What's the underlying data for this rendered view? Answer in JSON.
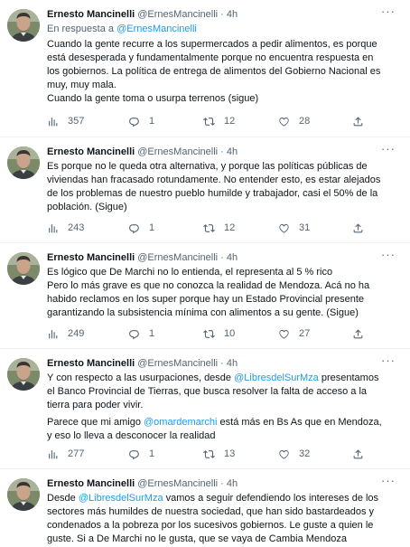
{
  "icons": {
    "more": "more-horizontal-icon",
    "views": "analytics-icon",
    "reply": "reply-bubble-icon",
    "retweet": "retweet-icon",
    "like": "heart-icon",
    "share": "share-upload-icon"
  },
  "colors": {
    "link": "#1d9bf0",
    "text": "#0f1419",
    "secondary": "#536471",
    "divider": "#eff3f4"
  },
  "tweets": [
    {
      "name": "Ernesto Mancinelli",
      "handle": "@ErnesMancinelli",
      "dot": "·",
      "time": "4h",
      "reply_prefix": "En respuesta a ",
      "reply_mention": "@ErnesMancinelli",
      "lines": [
        "Cuando la gente recurre a los supermercados a pedir alimentos, es porque",
        "está desesperada y fundamentalmente porque no encuentra respuesta en",
        "los gobiernos. La política de entrega de alimentos del Gobierno Nacional es",
        "muy, muy mala.",
        "Cuando la gente toma o usurpa terrenos (sigue)"
      ],
      "views": "357",
      "replies": "1",
      "retweets": "12",
      "likes": "28"
    },
    {
      "name": "Ernesto Mancinelli",
      "handle": "@ErnesMancinelli",
      "dot": "·",
      "time": "4h",
      "lines": [
        "Es porque no le queda otra alternativa, y porque las políticas públicas de",
        "viviendas han fracasado rotundamente. No entender esto, es estar alejados",
        "de los problemas de nuestro pueblo humilde y trabajador, casi el 50% de la",
        "población. (Sigue)"
      ],
      "views": "243",
      "replies": "1",
      "retweets": "12",
      "likes": "31"
    },
    {
      "name": "Ernesto Mancinelli",
      "handle": "@ErnesMancinelli",
      "dot": "·",
      "time": "4h",
      "lines": [
        "Es lógico que De Marchi no lo entienda, el representa al 5 % rico",
        "Pero lo más grave es que no conozca la realidad de Mendoza. Acá no ha",
        "habido reclamos en los super porque hay un Estado Provincial presente",
        "garantizando la subsistencia mínima con alimentos a su gente. (Sigue)"
      ],
      "views": "249",
      "replies": "1",
      "retweets": "10",
      "likes": "27"
    },
    {
      "name": "Ernesto Mancinelli",
      "handle": "@ErnesMancinelli",
      "dot": "·",
      "time": "4h",
      "line1_pre": "Y con respecto a las usurpaciones, desde ",
      "line1_mention": "@LibresdelSurMza",
      "line1_post": " presentamos",
      "lines_a": [
        "el Banco Provincial de Tierras, que busca resolver la falta de acceso a la",
        "tierra para poder vivir."
      ],
      "line4_pre": "Parece que mi amigo ",
      "line4_mention": "@omardemarchi",
      "line4_post": " está más en Bs As que en Mendoza,",
      "line5": "y eso lo lleva a desconocer la realidad",
      "views": "277",
      "replies": "1",
      "retweets": "13",
      "likes": "32"
    },
    {
      "name": "Ernesto Mancinelli",
      "handle": "@ErnesMancinelli",
      "dot": "·",
      "time": "4h",
      "line1_pre": "Desde ",
      "line1_mention": "@LibresdelSurMza",
      "line1_post": " vamos a seguir defendiendo los intereses de los",
      "lines_a": [
        "sectores más humildes de nuestra sociedad, que han sido bastardeados y",
        "condenados a la pobreza por los sucesivos gobiernos.  Le guste a quien le",
        "guste. Si a De Marchi no le gusta, que se vaya de Cambia Mendoza"
      ]
    }
  ]
}
